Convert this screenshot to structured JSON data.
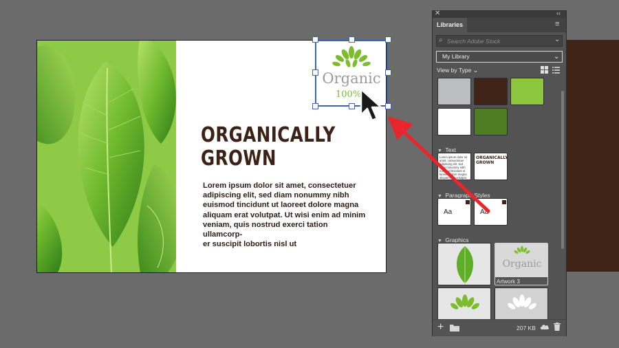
{
  "artboard": {
    "headline": [
      "ORGANICALLY",
      "GROWN"
    ],
    "body": "Lorem ipsum dolor sit amet, consectetuer adipiscing elit, sed diam nonummy nibh euismod tincidunt ut laoreet dolore magna aliquam erat volutpat. Ut wisi enim ad minim veniam, quis nostrud exerci tation ullamcorper suscipit lobortis nisl ut",
    "body_lines": [
      "Lorem ipsum dolor sit amet, consectetuer",
      "adipiscing elit, sed diam nonummy nibh",
      "euismod tincidunt ut laoreet dolore magna",
      "aliquam erat volutpat. Ut wisi enim ad minim",
      "veniam, quis nostrud exerci tation ullamcorp-",
      "er suscipit lobortis nisl ut"
    ],
    "logo": {
      "word": "Organic",
      "percent": "100%"
    }
  },
  "panel": {
    "tab": "Libraries",
    "search_placeholder": "Search Adobe Stock",
    "library": "My Library",
    "view_by": "View by Type",
    "sections": {
      "text": "Text",
      "paragraph_styles": "Paragraph Styles",
      "graphics": "Graphics"
    },
    "text_thumb_heading": [
      "ORGANICALLY",
      "GROWN"
    ],
    "para_style_sample": "Aa",
    "artwork_label": "Artwork 3",
    "storage": "207 KB"
  },
  "colors": {
    "selection": "#3f62b2",
    "arrow": "#e8262b",
    "swatches": [
      "#bcbdbf",
      "#3e2316",
      "#8dc63f",
      "#ffffff",
      "#4e7d23"
    ],
    "headline": "#3b2116",
    "leaf_green": "#7dbc2c"
  },
  "icons": [
    "close-icon",
    "collapse-icon",
    "panel-menu-icon",
    "search-icon",
    "chevron-down-icon",
    "grid-view-icon",
    "list-view-icon",
    "add-icon",
    "folder-icon",
    "cloud-icon",
    "trash-icon",
    "cursor-icon"
  ]
}
